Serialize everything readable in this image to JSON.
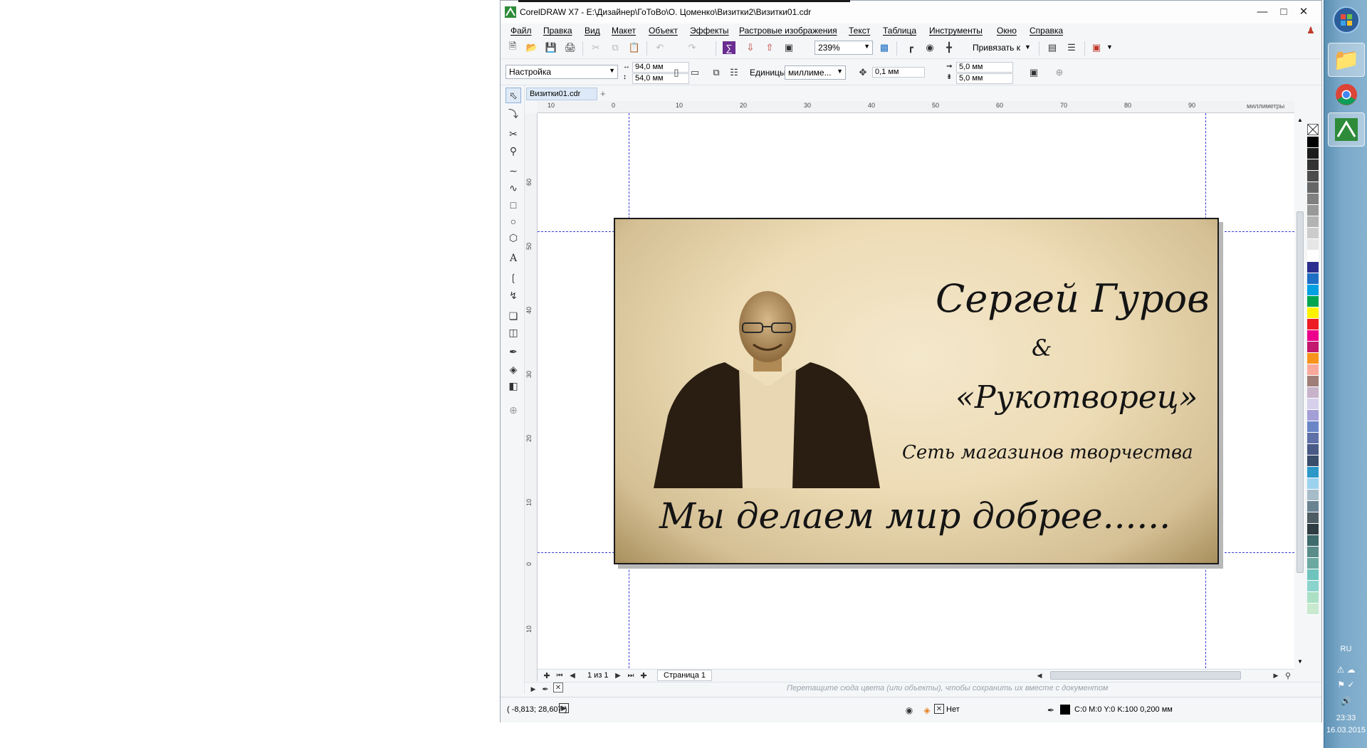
{
  "window": {
    "title": "CorelDRAW X7 - E:\\Дизайнер\\ГоТоВо\\О. Цоменко\\Визитки2\\Визитки01.cdr",
    "minimize_icon": "minimize-icon",
    "maximize_icon": "maximize-icon",
    "close_icon": "close-icon"
  },
  "menu": [
    "Файл",
    "Правка",
    "Вид",
    "Макет",
    "Объект",
    "Эффекты",
    "Растровые изображения",
    "Текст",
    "Таблица",
    "Инструменты",
    "Окно",
    "Справка"
  ],
  "toolbar": {
    "zoom_value": "239%",
    "snap_label": "Привязать к"
  },
  "property_bar": {
    "preset": "Настройка",
    "width": "94,0 мм",
    "height": "54,0 мм",
    "units_label": "Единицы:",
    "units_value": "миллиме...",
    "nudge": "0,1 мм",
    "dup_x": "5,0 мм",
    "dup_y": "5,0 мм"
  },
  "document_tab": "Визитки01.cdr",
  "ruler": {
    "unit": "миллиметры",
    "h_labels": [
      "10",
      "0",
      "10",
      "20",
      "30",
      "40",
      "50",
      "60",
      "70",
      "80",
      "90"
    ],
    "v_labels": [
      "60",
      "50",
      "40",
      "30",
      "20",
      "10",
      "0",
      "10"
    ]
  },
  "card": {
    "name_line": "Сергей Гуров",
    "ampersand": "&",
    "company": "«Рукотворец»",
    "tagline": "Сеть магазинов творчества",
    "slogan": "Мы делаем мир добрее......"
  },
  "page_nav": {
    "counter": "1 из 1",
    "page_tab": "Страница 1"
  },
  "doc_palette_hint": "Перетащите сюда цвета (или объекты), чтобы сохранить их вместе с документом",
  "status": {
    "coords": "( -8,813; 28,607 )",
    "fill_label": "Нет",
    "outline_info": "C:0 M:0 Y:0 K:100  0,200 мм"
  },
  "palette_colors": [
    "#000000",
    "#1c1c1c",
    "#333333",
    "#4d4d4d",
    "#666666",
    "#808080",
    "#999999",
    "#b3b3b3",
    "#cccccc",
    "#e6e6e6",
    "#ffffff",
    "#2b2e8f",
    "#1e6fc4",
    "#00a0e3",
    "#00a651",
    "#fff200",
    "#ed1c24",
    "#ec008c",
    "#c2186f",
    "#f7941d",
    "#f9a99b",
    "#9e7e77",
    "#c7b3c9",
    "#d6d0ec",
    "#a49fd6",
    "#6b86c7",
    "#5f6fa8",
    "#4a5a86",
    "#3a4d6b",
    "#2d97c8",
    "#9bd2ee",
    "#a6bcc8",
    "#6a8391",
    "#4e5c63",
    "#2f3d42",
    "#3e6b6b",
    "#5a8d8a",
    "#6ba9a0",
    "#6fc3bd",
    "#8bd3cd",
    "#abe0c5",
    "#c9e9cf"
  ],
  "taskbar": {
    "language": "RU",
    "time": "23:33",
    "date": "16.03.2015"
  }
}
